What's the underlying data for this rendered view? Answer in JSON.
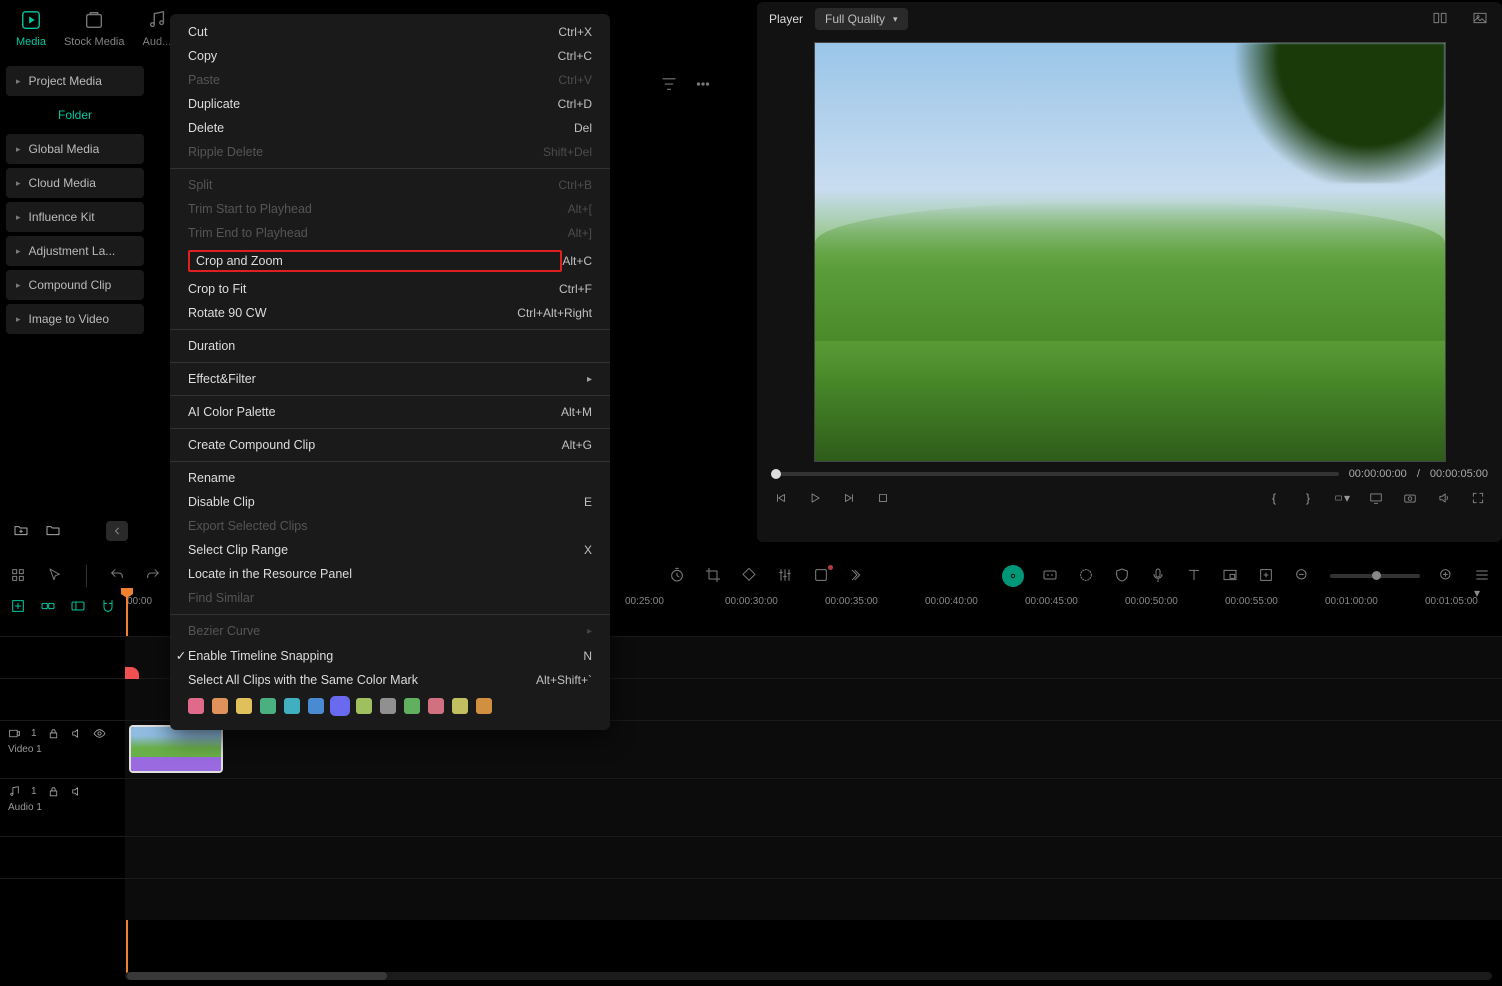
{
  "topTabs": {
    "media": "Media",
    "stockMedia": "Stock Media",
    "audio": "Aud..."
  },
  "sidebar": {
    "projectMedia": "Project Media",
    "folder": "Folder",
    "globalMedia": "Global Media",
    "cloudMedia": "Cloud Media",
    "influenceKit": "Influence Kit",
    "adjustmentLayer": "Adjustment La...",
    "compoundClip": "Compound Clip",
    "imageToVideo": "Image to Video"
  },
  "player": {
    "title": "Player",
    "quality": "Full Quality",
    "currentTime": "00:00:00:00",
    "sep": "/",
    "totalTime": "00:00:05:00"
  },
  "contextMenu": {
    "cut": {
      "label": "Cut",
      "shortcut": "Ctrl+X"
    },
    "copy": {
      "label": "Copy",
      "shortcut": "Ctrl+C"
    },
    "paste": {
      "label": "Paste",
      "shortcut": "Ctrl+V"
    },
    "duplicate": {
      "label": "Duplicate",
      "shortcut": "Ctrl+D"
    },
    "delete": {
      "label": "Delete",
      "shortcut": "Del"
    },
    "rippleDelete": {
      "label": "Ripple Delete",
      "shortcut": "Shift+Del"
    },
    "split": {
      "label": "Split",
      "shortcut": "Ctrl+B"
    },
    "trimStart": {
      "label": "Trim Start to Playhead",
      "shortcut": "Alt+["
    },
    "trimEnd": {
      "label": "Trim End to Playhead",
      "shortcut": "Alt+]"
    },
    "cropZoom": {
      "label": "Crop and Zoom",
      "shortcut": "Alt+C"
    },
    "cropFit": {
      "label": "Crop to Fit",
      "shortcut": "Ctrl+F"
    },
    "rotate": {
      "label": "Rotate 90 CW",
      "shortcut": "Ctrl+Alt+Right"
    },
    "duration": {
      "label": "Duration"
    },
    "effectFilter": {
      "label": "Effect&Filter"
    },
    "aiColor": {
      "label": "AI Color Palette",
      "shortcut": "Alt+M"
    },
    "createCompound": {
      "label": "Create Compound Clip",
      "shortcut": "Alt+G"
    },
    "rename": {
      "label": "Rename"
    },
    "disableClip": {
      "label": "Disable Clip",
      "shortcut": "E"
    },
    "exportSelected": {
      "label": "Export Selected Clips"
    },
    "selectRange": {
      "label": "Select Clip Range",
      "shortcut": "X"
    },
    "locate": {
      "label": "Locate in the Resource Panel"
    },
    "findSimilar": {
      "label": "Find Similar"
    },
    "bezier": {
      "label": "Bezier Curve"
    },
    "snapping": {
      "label": "Enable Timeline Snapping",
      "shortcut": "N"
    },
    "selectSameColor": {
      "label": "Select All Clips with the Same Color Mark",
      "shortcut": "Alt+Shift+`"
    }
  },
  "colors": [
    "#e06a8a",
    "#e0925a",
    "#e0c05a",
    "#4ab080",
    "#40b0c0",
    "#4a8ad0",
    "#6a6af0",
    "#a0c060",
    "#909090",
    "#60b060",
    "#d07080",
    "#c0c060",
    "#d09040"
  ],
  "ruler": [
    "00:00",
    "00:25:00",
    "00:00:30:00",
    "00:00:35:00",
    "00:00:40:00",
    "00:00:45:00",
    "00:00:50:00",
    "00:00:55:00",
    "00:01:00:00",
    "00:01:05:00"
  ],
  "tracks": {
    "video1": {
      "badge": "1",
      "name": "Video 1"
    },
    "audio1": {
      "badge": "1",
      "name": "Audio 1"
    }
  }
}
